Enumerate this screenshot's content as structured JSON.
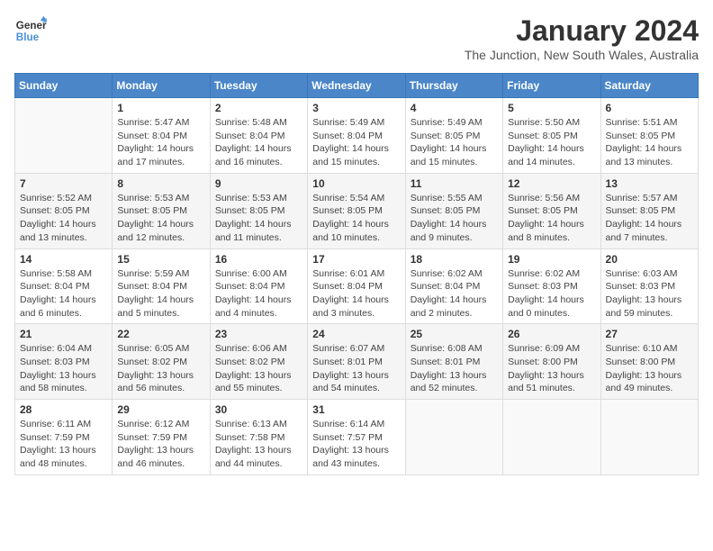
{
  "header": {
    "logo_line1": "General",
    "logo_line2": "Blue",
    "month": "January 2024",
    "location": "The Junction, New South Wales, Australia"
  },
  "days_of_week": [
    "Sunday",
    "Monday",
    "Tuesday",
    "Wednesday",
    "Thursday",
    "Friday",
    "Saturday"
  ],
  "weeks": [
    [
      {
        "day": "",
        "info": ""
      },
      {
        "day": "1",
        "info": "Sunrise: 5:47 AM\nSunset: 8:04 PM\nDaylight: 14 hours\nand 17 minutes."
      },
      {
        "day": "2",
        "info": "Sunrise: 5:48 AM\nSunset: 8:04 PM\nDaylight: 14 hours\nand 16 minutes."
      },
      {
        "day": "3",
        "info": "Sunrise: 5:49 AM\nSunset: 8:04 PM\nDaylight: 14 hours\nand 15 minutes."
      },
      {
        "day": "4",
        "info": "Sunrise: 5:49 AM\nSunset: 8:05 PM\nDaylight: 14 hours\nand 15 minutes."
      },
      {
        "day": "5",
        "info": "Sunrise: 5:50 AM\nSunset: 8:05 PM\nDaylight: 14 hours\nand 14 minutes."
      },
      {
        "day": "6",
        "info": "Sunrise: 5:51 AM\nSunset: 8:05 PM\nDaylight: 14 hours\nand 13 minutes."
      }
    ],
    [
      {
        "day": "7",
        "info": "Sunrise: 5:52 AM\nSunset: 8:05 PM\nDaylight: 14 hours\nand 13 minutes."
      },
      {
        "day": "8",
        "info": "Sunrise: 5:53 AM\nSunset: 8:05 PM\nDaylight: 14 hours\nand 12 minutes."
      },
      {
        "day": "9",
        "info": "Sunrise: 5:53 AM\nSunset: 8:05 PM\nDaylight: 14 hours\nand 11 minutes."
      },
      {
        "day": "10",
        "info": "Sunrise: 5:54 AM\nSunset: 8:05 PM\nDaylight: 14 hours\nand 10 minutes."
      },
      {
        "day": "11",
        "info": "Sunrise: 5:55 AM\nSunset: 8:05 PM\nDaylight: 14 hours\nand 9 minutes."
      },
      {
        "day": "12",
        "info": "Sunrise: 5:56 AM\nSunset: 8:05 PM\nDaylight: 14 hours\nand 8 minutes."
      },
      {
        "day": "13",
        "info": "Sunrise: 5:57 AM\nSunset: 8:05 PM\nDaylight: 14 hours\nand 7 minutes."
      }
    ],
    [
      {
        "day": "14",
        "info": "Sunrise: 5:58 AM\nSunset: 8:04 PM\nDaylight: 14 hours\nand 6 minutes."
      },
      {
        "day": "15",
        "info": "Sunrise: 5:59 AM\nSunset: 8:04 PM\nDaylight: 14 hours\nand 5 minutes."
      },
      {
        "day": "16",
        "info": "Sunrise: 6:00 AM\nSunset: 8:04 PM\nDaylight: 14 hours\nand 4 minutes."
      },
      {
        "day": "17",
        "info": "Sunrise: 6:01 AM\nSunset: 8:04 PM\nDaylight: 14 hours\nand 3 minutes."
      },
      {
        "day": "18",
        "info": "Sunrise: 6:02 AM\nSunset: 8:04 PM\nDaylight: 14 hours\nand 2 minutes."
      },
      {
        "day": "19",
        "info": "Sunrise: 6:02 AM\nSunset: 8:03 PM\nDaylight: 14 hours\nand 0 minutes."
      },
      {
        "day": "20",
        "info": "Sunrise: 6:03 AM\nSunset: 8:03 PM\nDaylight: 13 hours\nand 59 minutes."
      }
    ],
    [
      {
        "day": "21",
        "info": "Sunrise: 6:04 AM\nSunset: 8:03 PM\nDaylight: 13 hours\nand 58 minutes."
      },
      {
        "day": "22",
        "info": "Sunrise: 6:05 AM\nSunset: 8:02 PM\nDaylight: 13 hours\nand 56 minutes."
      },
      {
        "day": "23",
        "info": "Sunrise: 6:06 AM\nSunset: 8:02 PM\nDaylight: 13 hours\nand 55 minutes."
      },
      {
        "day": "24",
        "info": "Sunrise: 6:07 AM\nSunset: 8:01 PM\nDaylight: 13 hours\nand 54 minutes."
      },
      {
        "day": "25",
        "info": "Sunrise: 6:08 AM\nSunset: 8:01 PM\nDaylight: 13 hours\nand 52 minutes."
      },
      {
        "day": "26",
        "info": "Sunrise: 6:09 AM\nSunset: 8:00 PM\nDaylight: 13 hours\nand 51 minutes."
      },
      {
        "day": "27",
        "info": "Sunrise: 6:10 AM\nSunset: 8:00 PM\nDaylight: 13 hours\nand 49 minutes."
      }
    ],
    [
      {
        "day": "28",
        "info": "Sunrise: 6:11 AM\nSunset: 7:59 PM\nDaylight: 13 hours\nand 48 minutes."
      },
      {
        "day": "29",
        "info": "Sunrise: 6:12 AM\nSunset: 7:59 PM\nDaylight: 13 hours\nand 46 minutes."
      },
      {
        "day": "30",
        "info": "Sunrise: 6:13 AM\nSunset: 7:58 PM\nDaylight: 13 hours\nand 44 minutes."
      },
      {
        "day": "31",
        "info": "Sunrise: 6:14 AM\nSunset: 7:57 PM\nDaylight: 13 hours\nand 43 minutes."
      },
      {
        "day": "",
        "info": ""
      },
      {
        "day": "",
        "info": ""
      },
      {
        "day": "",
        "info": ""
      }
    ]
  ]
}
